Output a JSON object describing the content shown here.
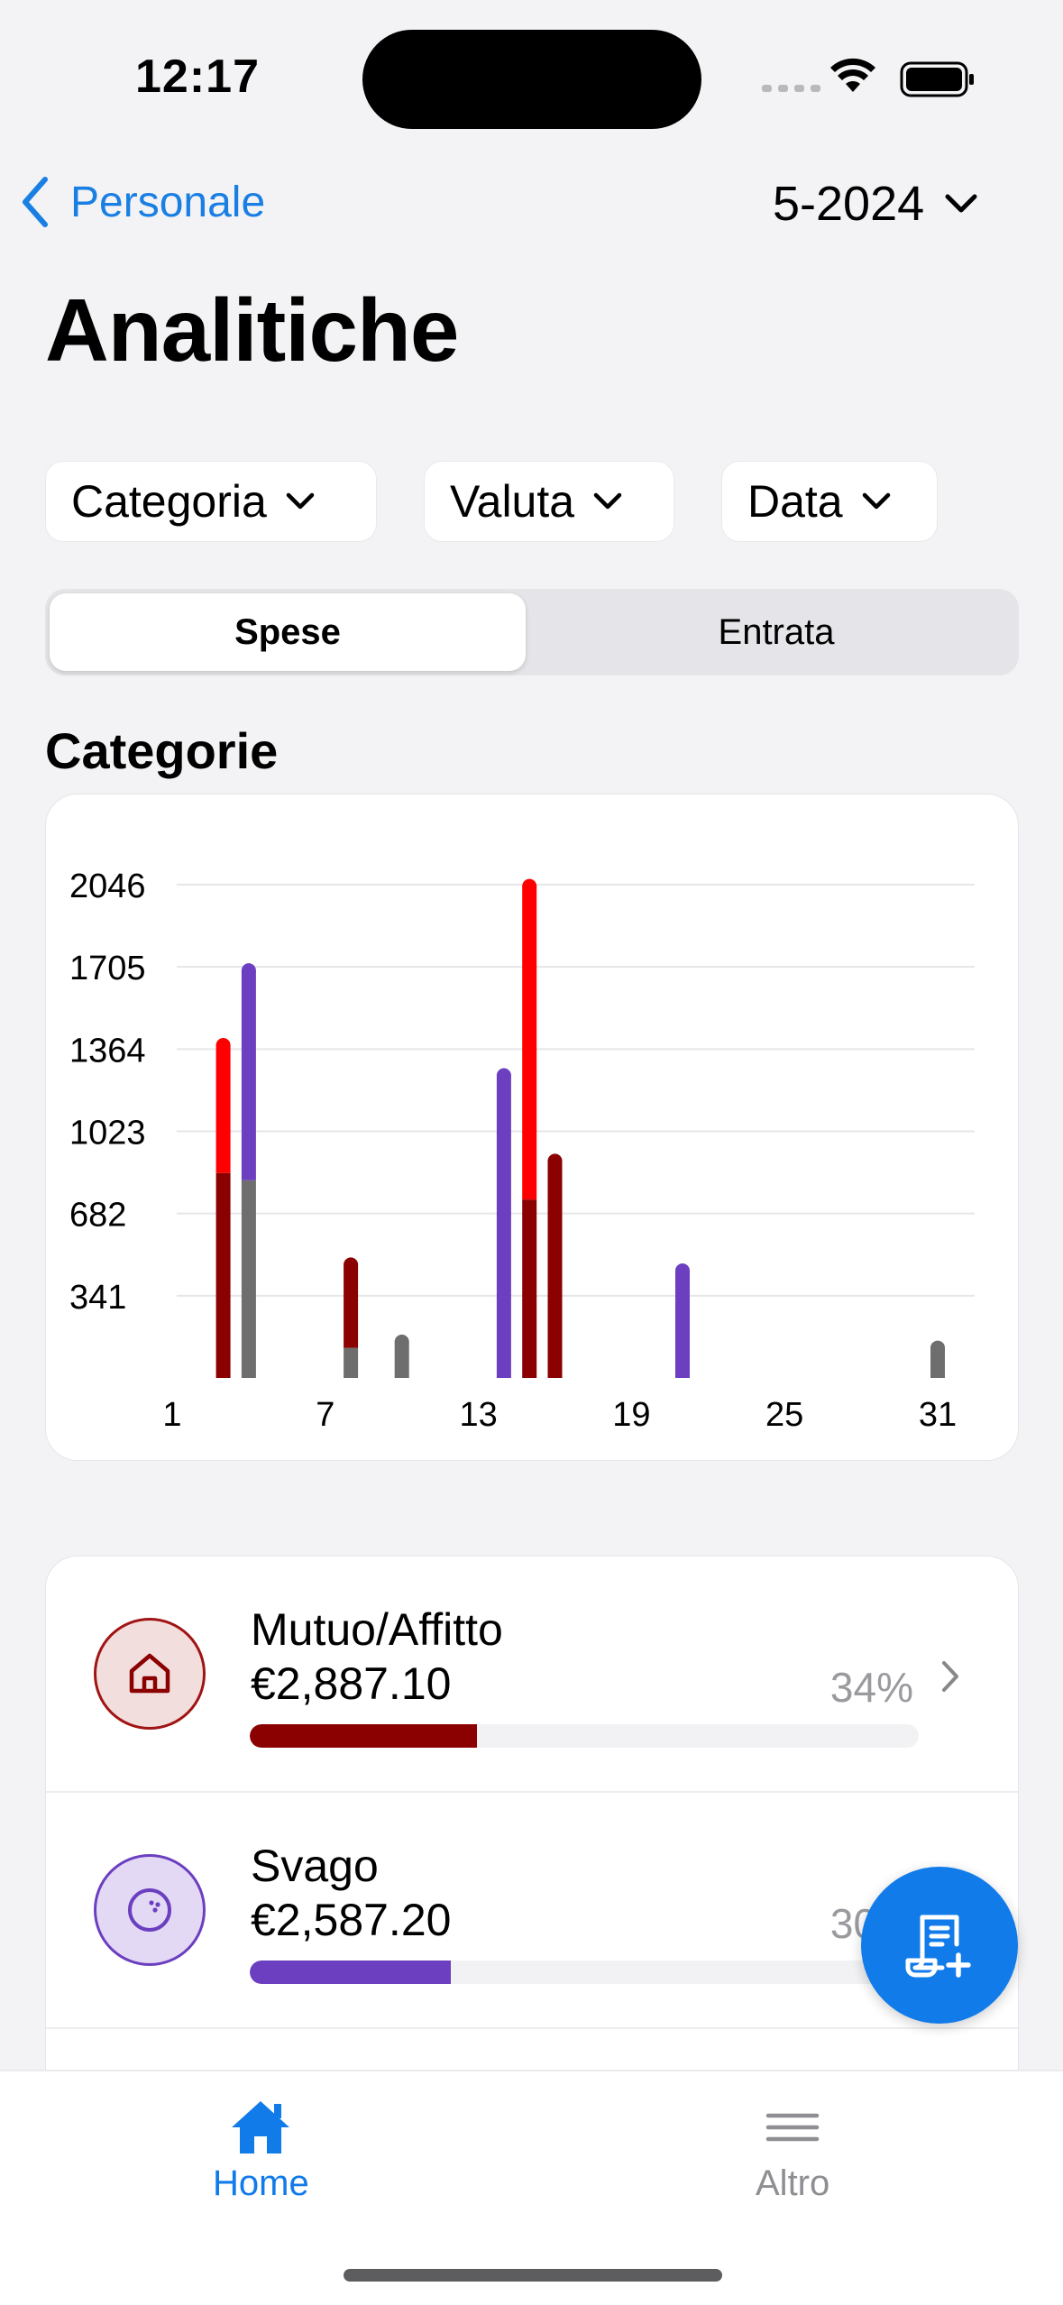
{
  "status_bar": {
    "time": "12:17"
  },
  "nav": {
    "back_label": "Personale",
    "period": "5-2024",
    "title": "Analitiche"
  },
  "filters": [
    {
      "label": "Categoria"
    },
    {
      "label": "Valuta"
    },
    {
      "label": "Data"
    }
  ],
  "segment": {
    "expenses": "Spese",
    "income": "Entrata",
    "selected": "Spese"
  },
  "section_title": "Categorie",
  "colors": {
    "accent": "#1a7fe3",
    "mutuo": "#8b0000",
    "svago": "#6b3fbf",
    "red": "#ff0000",
    "gray": "#6e6e6e"
  },
  "chart_data": {
    "type": "bar",
    "stacked": true,
    "x_ticks": [
      "1",
      "7",
      "13",
      "19",
      "25",
      "31"
    ],
    "y_ticks": [
      "341",
      "682",
      "1023",
      "1364",
      "1705",
      "2046"
    ],
    "xlim": [
      1,
      31
    ],
    "ylim": [
      0,
      2046
    ],
    "grid": true,
    "bars": [
      {
        "day": 3,
        "segments": [
          {
            "color": "#8b0000",
            "value": 850
          },
          {
            "color": "#ff0000",
            "value": 530
          }
        ]
      },
      {
        "day": 4,
        "segments": [
          {
            "color": "#6e6e6e",
            "value": 820
          },
          {
            "color": "#6b3fbf",
            "value": 870
          }
        ]
      },
      {
        "day": 8,
        "segments": [
          {
            "color": "#6e6e6e",
            "value": 125
          },
          {
            "color": "#8b0000",
            "value": 345
          }
        ]
      },
      {
        "day": 10,
        "segments": [
          {
            "color": "#6e6e6e",
            "value": 150
          }
        ]
      },
      {
        "day": 14,
        "segments": [
          {
            "color": "#6b3fbf",
            "value": 1255
          }
        ]
      },
      {
        "day": 15,
        "segments": [
          {
            "color": "#8b0000",
            "value": 740
          },
          {
            "color": "#ff0000",
            "value": 1300
          }
        ]
      },
      {
        "day": 16,
        "segments": [
          {
            "color": "#8b0000",
            "value": 900
          }
        ]
      },
      {
        "day": 21,
        "segments": [
          {
            "color": "#6b3fbf",
            "value": 445
          }
        ]
      },
      {
        "day": 31,
        "segments": [
          {
            "color": "#6e6e6e",
            "value": 125
          }
        ]
      }
    ]
  },
  "categories": [
    {
      "name": "Mutuo/Affitto",
      "amount": "€2,887.10",
      "percent": "34%",
      "fraction": 0.34,
      "color": "#8b0000",
      "icon": "house-icon"
    },
    {
      "name": "Svago",
      "amount": "€2,587.20",
      "percent": "30%",
      "fraction": 0.3,
      "color": "#6b3fbf",
      "icon": "bowling-ball-icon"
    }
  ],
  "tabs": [
    {
      "label": "Home",
      "icon": "home-icon",
      "active": true
    },
    {
      "label": "Altro",
      "icon": "menu-icon",
      "active": false
    }
  ],
  "fab": {
    "icon": "add-receipt-icon"
  }
}
